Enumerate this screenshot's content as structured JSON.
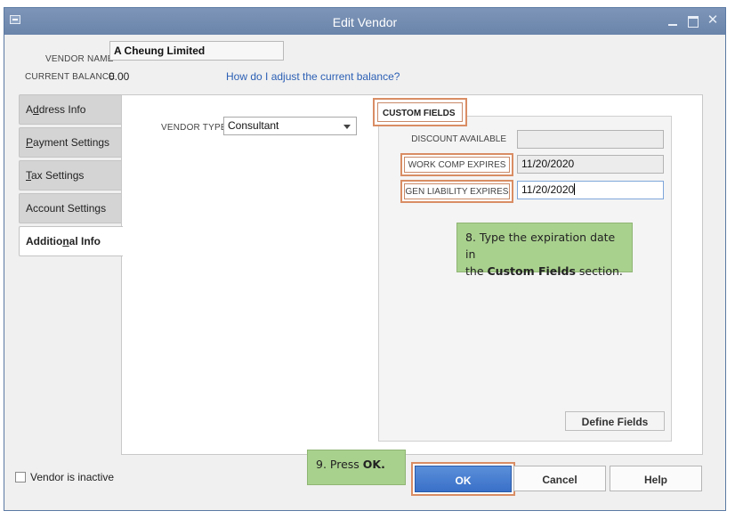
{
  "window": {
    "title": "Edit Vendor"
  },
  "header": {
    "vendor_name_label": "VENDOR NAME",
    "vendor_name_value": "A Cheung Limited",
    "current_balance_label": "CURRENT BALANCE",
    "current_balance_value": "0.00",
    "balance_link": "How do I adjust the current balance?"
  },
  "tabs": [
    {
      "label": "Address Info",
      "accel": "d"
    },
    {
      "label": "Payment Settings",
      "accel": "P"
    },
    {
      "label": "Tax Settings",
      "accel": "T"
    },
    {
      "label": "Account Settings",
      "accel": "g"
    },
    {
      "label": "Additional Info",
      "accel": "n",
      "active": true
    }
  ],
  "additional_info": {
    "vendor_type_label": "VENDOR TYPE",
    "vendor_type_value": "Consultant",
    "custom_fields": {
      "title": "CUSTOM FIELDS",
      "fields": [
        {
          "label": "DISCOUNT AVAILABLE",
          "value": ""
        },
        {
          "label": "WORK COMP EXPIRES",
          "value": "11/20/2020"
        },
        {
          "label": "GEN LIABILITY EXPIRES",
          "value": "11/20/2020"
        }
      ],
      "define_fields_button": "Define Fields"
    }
  },
  "callouts": {
    "step8_line1": "8. Type the expiration date in",
    "step8_line2_pre": "the ",
    "step8_line2_bold": "Custom Fields",
    "step8_line2_post": " section.",
    "step9_pre": "9. Press ",
    "step9_bold": "OK."
  },
  "footer": {
    "vendor_inactive_label": "Vendor is inactive",
    "ok_button": "OK",
    "cancel_button": "Cancel",
    "help_button": "Help"
  },
  "colors": {
    "highlight_border": "#d98d64",
    "callout_bg": "#a9d18e",
    "ok_button_bg": "#3a70c8",
    "titlebar_bg": "#6a84aa",
    "link": "#2b5fb4"
  }
}
